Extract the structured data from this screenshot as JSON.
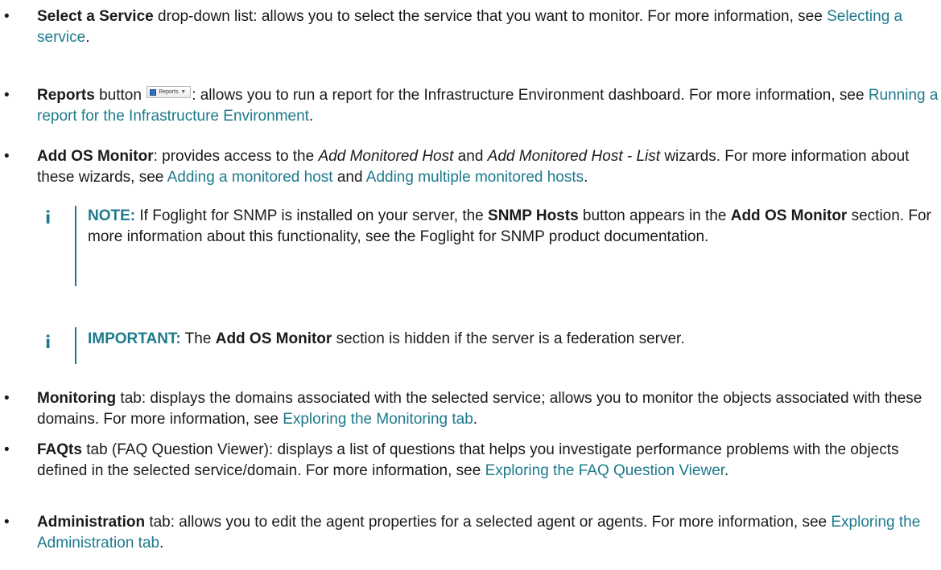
{
  "bullet_char": "•",
  "items": {
    "select_service": {
      "bold": "Select a Service",
      "text1": " drop-down list: allows you to select the service that you want to monitor. For more information, see ",
      "link": "Selecting a service",
      "text2": "."
    },
    "reports": {
      "bold": "Reports",
      "text1": " button ",
      "button_label": "Reports",
      "button_caret": "▼",
      "text2": ": allows you to run a report for the Infrastructure Environment dashboard. For more information, see ",
      "link": "Running a report for the Infrastructure Environment",
      "text3": "."
    },
    "add_os_monitor": {
      "bold": "Add OS Monitor",
      "text1": ": provides access to the ",
      "italic1": "Add Monitored Host",
      "text2": " and ",
      "italic2": "Add Monitored Host - List",
      "text3": " wizards. For more information about these wizards, see ",
      "link1": "Adding a monitored host",
      "text4": " and ",
      "link2": "Adding multiple monitored hosts",
      "text5": "."
    },
    "note1": {
      "icon": "i",
      "tag": "NOTE:",
      "text1": " If Foglight for SNMP is installed on your server, the ",
      "bold1": "SNMP Hosts",
      "text2": " button appears in the ",
      "bold2": "Add OS Monitor",
      "text3": " section. For more information about this functionality, see the Foglight for SNMP product documentation."
    },
    "note2": {
      "icon": "i",
      "tag": "IMPORTANT:",
      "text1": " The ",
      "bold1": "Add OS Monitor",
      "text2": " section is hidden if the server is a federation server."
    },
    "monitoring": {
      "bold": "Monitoring",
      "text1": " tab: displays the domains associated with the selected service; allows you to monitor the objects associated with these domains. For more information, see ",
      "link": "Exploring the Monitoring tab",
      "text2": "."
    },
    "faqts": {
      "bold": "FAQts",
      "text1": " tab (FAQ Question Viewer): displays a list of questions that helps you investigate performance problems with the objects defined in the selected service/domain. For more information, see ",
      "link": "Exploring the FAQ Question Viewer",
      "text2": "."
    },
    "administration": {
      "bold": "Administration",
      "text1": " tab: allows you to edit the agent properties for a selected agent or agents. For more information, see ",
      "link": "Exploring the Administration tab",
      "text2": "."
    }
  },
  "colors": {
    "link": "#1d7a8c",
    "note_accent": "#1d7a8c",
    "text": "#1a1a1a"
  }
}
